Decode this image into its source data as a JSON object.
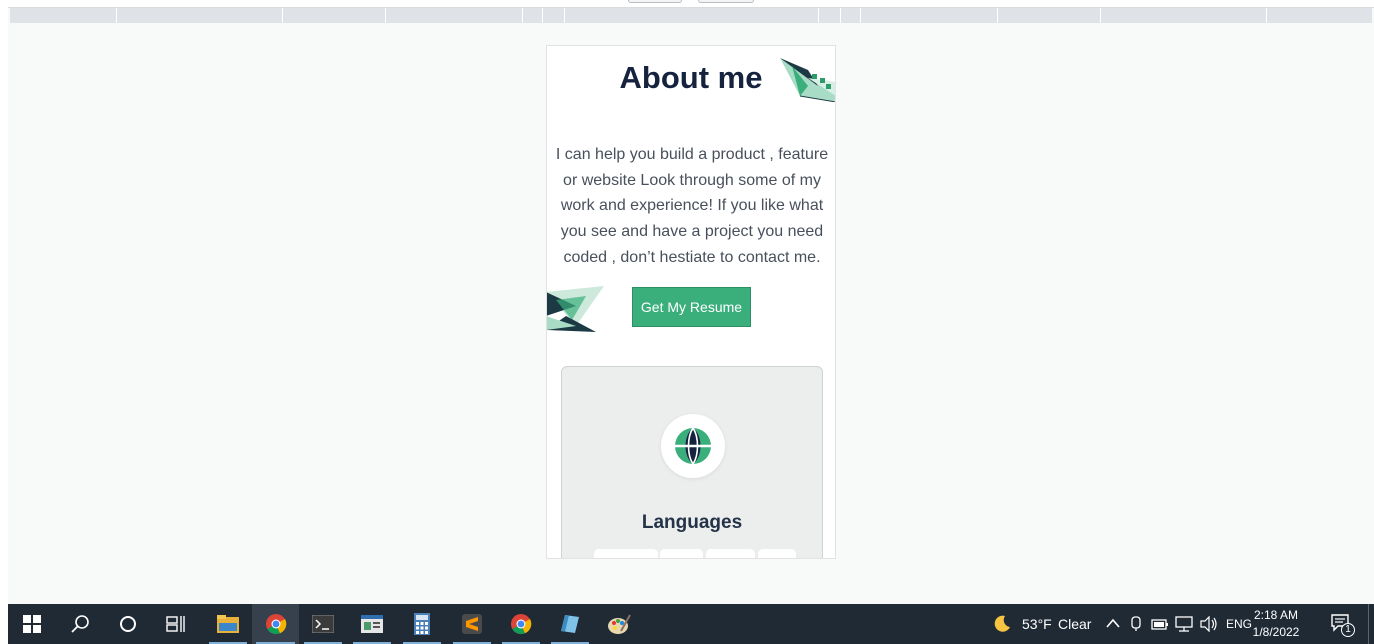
{
  "page": {
    "about_title": "About me",
    "about_text": "I can help you build a product , feature or website Look through some of my work and experience! If you like what you see and have a project you need coded , don’t hestiate to contact me.",
    "resume_button": "Get My Resume",
    "languages_card": {
      "title": "Languages",
      "icon": "globe-icon"
    }
  },
  "colors": {
    "accent": "#3aaf7c",
    "title": "#16233f",
    "text": "#48505c",
    "taskbar": "#202a35"
  },
  "taskbar": {
    "apps": [
      {
        "name": "start-button",
        "icon": "windows-logo-icon"
      },
      {
        "name": "search-button",
        "icon": "search-icon"
      },
      {
        "name": "cortana-button",
        "icon": "circle-icon"
      },
      {
        "name": "task-view-button",
        "icon": "task-view-icon"
      },
      {
        "name": "file-explorer",
        "icon": "folder-icon"
      },
      {
        "name": "chrome",
        "icon": "chrome-icon"
      },
      {
        "name": "terminal",
        "icon": "terminal-icon"
      },
      {
        "name": "app-window",
        "icon": "window-icon"
      },
      {
        "name": "calculator",
        "icon": "calculator-icon"
      },
      {
        "name": "sublime-text",
        "icon": "sublime-icon"
      },
      {
        "name": "chrome-2",
        "icon": "chrome-icon"
      },
      {
        "name": "notepad",
        "icon": "notepad-icon"
      },
      {
        "name": "paint",
        "icon": "paint-icon"
      }
    ],
    "weather": {
      "temp": "53°F",
      "condition": "Clear",
      "icon": "moon-icon"
    },
    "language": "ENG",
    "time": "2:18 AM",
    "date": "1/8/2022",
    "notification_count": "1"
  }
}
